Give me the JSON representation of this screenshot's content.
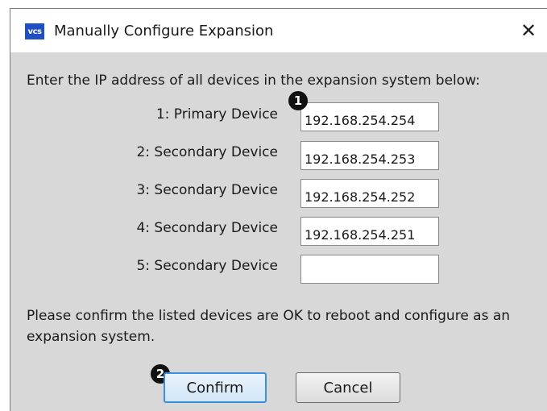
{
  "window": {
    "title": "Manually Configure Expansion",
    "logo_text": "vcs",
    "close_glyph": "✕"
  },
  "instruction": "Enter the IP address of all devices in the expansion system below:",
  "devices": [
    {
      "label": "1: Primary Device",
      "value": "192.168.254.254"
    },
    {
      "label": "2: Secondary Device",
      "value": "192.168.254.253"
    },
    {
      "label": "3: Secondary Device",
      "value": "192.168.254.252"
    },
    {
      "label": "4: Secondary Device",
      "value": "192.168.254.251"
    },
    {
      "label": "5: Secondary Device",
      "value": ""
    }
  ],
  "confirm_message": "Please confirm the listed devices are OK to reboot and configure as an expansion system.",
  "buttons": {
    "confirm": "Confirm",
    "cancel": "Cancel"
  },
  "callouts": [
    "1",
    "2"
  ],
  "colors": {
    "dialog_background": "#d8d8d8",
    "logo": "#1f4fc4",
    "confirm_border": "#3c8fd8"
  }
}
